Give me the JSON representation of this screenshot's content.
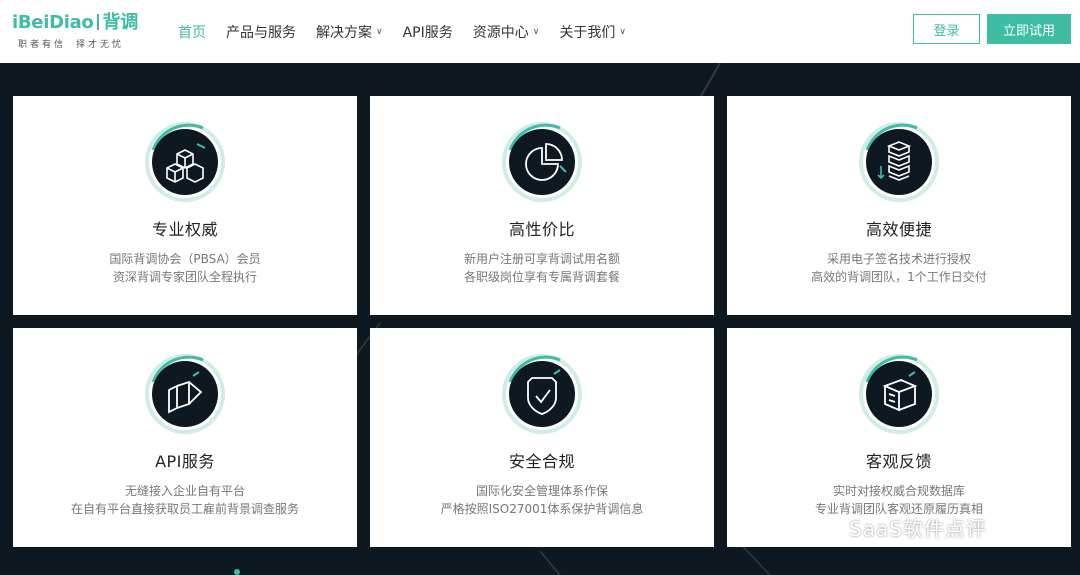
{
  "logo": {
    "text_left": "iBeiDiao",
    "text_right": "背调",
    "tagline_left": "职者有信",
    "tagline_right": "择才无忧"
  },
  "nav": {
    "items": [
      {
        "label": "首页",
        "active": true,
        "dropdown": false
      },
      {
        "label": "产品与服务",
        "active": false,
        "dropdown": false
      },
      {
        "label": "解决方案",
        "active": false,
        "dropdown": true
      },
      {
        "label": "API服务",
        "active": false,
        "dropdown": false
      },
      {
        "label": "资源中心",
        "active": false,
        "dropdown": true
      },
      {
        "label": "关于我们",
        "active": false,
        "dropdown": true
      }
    ]
  },
  "header": {
    "login_label": "登录",
    "try_label": "立即试用"
  },
  "cards": [
    {
      "icon": "cubes-icon",
      "title": "专业权威",
      "line1": "国际背调协会（PBSA）会员",
      "line2": "资深背调专家团队全程执行"
    },
    {
      "icon": "pie-chart-icon",
      "title": "高性价比",
      "line1": "新用户注册可享背调试用名额",
      "line2": "各职级岗位享有专属背调套餐"
    },
    {
      "icon": "stack-icon",
      "title": "高效便捷",
      "line1": "采用电子签名技术进行授权",
      "line2": "高效的背调团队，1个工作日交付"
    },
    {
      "icon": "api-plug-icon",
      "title": "API服务",
      "line1": "无缝接入企业自有平台",
      "line2": "在自有平台直接获取员工雇前背景调查服务"
    },
    {
      "icon": "shield-check-icon",
      "title": "安全合规",
      "line1": "国际化安全管理体系作保",
      "line2": "严格按照ISO27001体系保护背调信息"
    },
    {
      "icon": "database-icon",
      "title": "客观反馈",
      "line1": "实时对接权威合规数据库",
      "line2": "专业背调团队客观还原履历真相"
    }
  ],
  "watermark": {
    "text": "SaaS软件点评"
  },
  "colors": {
    "accent": "#3ebda4",
    "background": "#0e1820",
    "card": "#ffffff"
  }
}
